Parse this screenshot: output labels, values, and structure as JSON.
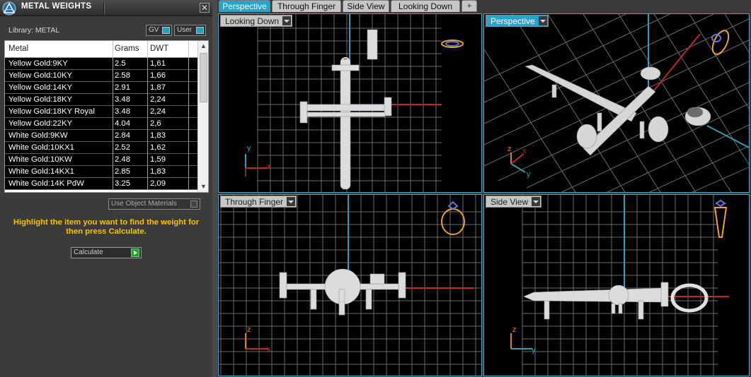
{
  "panel": {
    "title": "METAL WEIGHTS",
    "close": "✕",
    "library_label": "Library: METAL",
    "gv_label": "GV",
    "user_label": "User",
    "columns": [
      "Metal",
      "Grams",
      "DWT"
    ],
    "rows": [
      [
        "Yellow Gold:9KY",
        "2.5",
        "1,61"
      ],
      [
        "Yellow Gold:10KY",
        "2.58",
        "1,66"
      ],
      [
        "Yellow Gold:14KY",
        "2.91",
        "1,87"
      ],
      [
        "Yellow Gold:18KY",
        "3.48",
        "2,24"
      ],
      [
        "Yellow Gold:18KY Royal",
        "3.48",
        "2,24"
      ],
      [
        "Yellow Gold:22KY",
        "4.04",
        "2,6"
      ],
      [
        "White Gold:9KW",
        "2.84",
        "1,83"
      ],
      [
        "White Gold:10KX1",
        "2.52",
        "1,62"
      ],
      [
        "White Gold:10KW",
        "2.48",
        "1,59"
      ],
      [
        "White Gold:14KX1",
        "2.85",
        "1,83"
      ],
      [
        "White Gold:14K PdW",
        "3.25",
        "2,09"
      ]
    ],
    "use_object_materials": "Use Object Materials",
    "hint": "Highlight the item you want to find the weight for then press Calculate.",
    "calculate_label": "Calculate"
  },
  "tabs": [
    "Perspective",
    "Through Finger",
    "Side View",
    "Looking Down"
  ],
  "tab_add": "+",
  "viewports": {
    "top_left": {
      "label": "Looking Down",
      "axis_a": "y",
      "axis_b": "x"
    },
    "top_right": {
      "label": "Perspective",
      "axis_a": "z",
      "axis_b": "x",
      "axis_c": "y"
    },
    "bottom_left": {
      "label": "Through Finger",
      "axis_a": "z",
      "axis_b": "x"
    },
    "bottom_right": {
      "label": "Side View",
      "axis_a": "z",
      "axis_b": "y"
    }
  },
  "colors": {
    "accent": "#29a3c8",
    "hint_text": "#f5c400",
    "axis_red": "#c0262a",
    "axis_cyan": "#2aa0b8",
    "grid": "#6a6a6a",
    "orange_axis": "#e07a20",
    "gizmo": "#f0a030"
  }
}
